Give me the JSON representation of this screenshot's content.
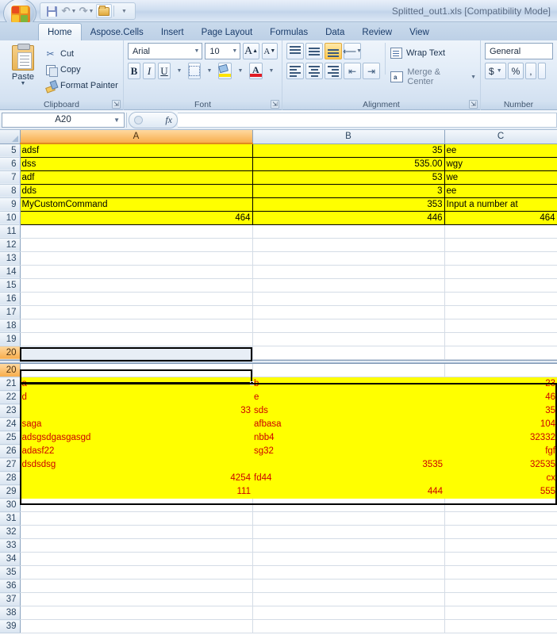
{
  "titlebar": {
    "filename": "Splitted_out1.xls  [Compatibility Mode]",
    "qat": {
      "save": "Save",
      "undo": "Undo",
      "redo": "Redo",
      "open": "Open",
      "customize": "Customize Quick Access Toolbar"
    }
  },
  "tabs": [
    {
      "label": "Home",
      "active": true
    },
    {
      "label": "Aspose.Cells",
      "active": false
    },
    {
      "label": "Insert",
      "active": false
    },
    {
      "label": "Page Layout",
      "active": false
    },
    {
      "label": "Formulas",
      "active": false
    },
    {
      "label": "Data",
      "active": false
    },
    {
      "label": "Review",
      "active": false
    },
    {
      "label": "View",
      "active": false
    }
  ],
  "ribbon": {
    "clipboard": {
      "label": "Clipboard",
      "paste": "Paste",
      "cut": "Cut",
      "copy": "Copy",
      "format_painter": "Format Painter"
    },
    "font": {
      "label": "Font",
      "family": "Arial",
      "size": "10",
      "grow_font": "A",
      "shrink_font": "A",
      "bold": "B",
      "italic": "I",
      "underline": "U",
      "fill_color_letter": "",
      "font_color_letter": "A"
    },
    "alignment": {
      "label": "Alignment",
      "wrap_text": "Wrap Text",
      "merge_center": "Merge & Center"
    },
    "number": {
      "label": "Number",
      "format": "General",
      "currency": "$",
      "percent": "%",
      "comma": ","
    }
  },
  "formulabar": {
    "namebox": "A20",
    "fx": "fx",
    "value": ""
  },
  "grid": {
    "columns": [
      "A",
      "B",
      "C"
    ],
    "active_column": "A",
    "active_row": "20",
    "top_pane_rows": [
      {
        "n": "5",
        "style": "yellowbox",
        "a": "adsf",
        "b": "35",
        "c": "ee",
        "a_align": "txt",
        "b_align": "num",
        "c_align": "txt"
      },
      {
        "n": "6",
        "style": "yellowbox",
        "a": "dss",
        "b": "535.00",
        "c": "wgy",
        "a_align": "txt",
        "b_align": "num",
        "c_align": "txt"
      },
      {
        "n": "7",
        "style": "yellowbox",
        "a": "adf",
        "b": "53",
        "c": "we",
        "a_align": "txt",
        "b_align": "num",
        "c_align": "txt"
      },
      {
        "n": "8",
        "style": "yellowbox",
        "a": "dds",
        "b": "3",
        "c": "ee",
        "a_align": "txt",
        "b_align": "num",
        "c_align": "txt"
      },
      {
        "n": "9",
        "style": "yellowbox",
        "a": "MyCustomCommand",
        "b": "353",
        "c": "Input a number at",
        "a_align": "txt",
        "b_align": "num",
        "c_align": "txt"
      },
      {
        "n": "10",
        "style": "yellowbox",
        "a": "464",
        "b": "446",
        "c": "464",
        "a_align": "num",
        "b_align": "num",
        "c_align": "num"
      },
      {
        "n": "11",
        "style": "blank",
        "a": "",
        "b": "",
        "c": "",
        "a_align": "txt",
        "b_align": "txt",
        "c_align": "txt"
      },
      {
        "n": "12",
        "style": "blank",
        "a": "",
        "b": "",
        "c": "",
        "a_align": "txt",
        "b_align": "txt",
        "c_align": "txt"
      },
      {
        "n": "13",
        "style": "blank",
        "a": "",
        "b": "",
        "c": "",
        "a_align": "txt",
        "b_align": "txt",
        "c_align": "txt"
      },
      {
        "n": "14",
        "style": "blank",
        "a": "",
        "b": "",
        "c": "",
        "a_align": "txt",
        "b_align": "txt",
        "c_align": "txt"
      },
      {
        "n": "15",
        "style": "blank",
        "a": "",
        "b": "",
        "c": "",
        "a_align": "txt",
        "b_align": "txt",
        "c_align": "txt"
      },
      {
        "n": "16",
        "style": "blank",
        "a": "",
        "b": "",
        "c": "",
        "a_align": "txt",
        "b_align": "txt",
        "c_align": "txt"
      },
      {
        "n": "17",
        "style": "blank",
        "a": "",
        "b": "",
        "c": "",
        "a_align": "txt",
        "b_align": "txt",
        "c_align": "txt"
      },
      {
        "n": "18",
        "style": "blank",
        "a": "",
        "b": "",
        "c": "",
        "a_align": "txt",
        "b_align": "txt",
        "c_align": "txt"
      },
      {
        "n": "19",
        "style": "blank",
        "a": "",
        "b": "",
        "c": "",
        "a_align": "txt",
        "b_align": "txt",
        "c_align": "txt"
      },
      {
        "n": "20",
        "style": "blank",
        "a": "",
        "b": "",
        "c": "",
        "a_align": "txt",
        "b_align": "txt",
        "c_align": "txt",
        "selected": true
      }
    ],
    "bottom_pane_rows": [
      {
        "n": "20",
        "style": "blank",
        "a": "",
        "b": "",
        "c": "",
        "a_align": "txt",
        "b_align": "txt",
        "c_align": "num",
        "selected": true
      },
      {
        "n": "21",
        "style": "yellowplain",
        "a": "a",
        "b": "b",
        "c": "23",
        "a_align": "txt",
        "b_align": "txt",
        "c_align": "num"
      },
      {
        "n": "22",
        "style": "yellowplain",
        "a": "d",
        "b": "e",
        "c": "46",
        "a_align": "txt",
        "b_align": "txt",
        "c_align": "num"
      },
      {
        "n": "23",
        "style": "yellowplain",
        "a": "33",
        "b": "sds",
        "c": "35",
        "a_align": "num",
        "b_align": "txt",
        "c_align": "num"
      },
      {
        "n": "24",
        "style": "yellowplain",
        "a": "saga",
        "b": "afbasa",
        "c": "104",
        "a_align": "txt",
        "b_align": "txt",
        "c_align": "num"
      },
      {
        "n": "25",
        "style": "yellowplain",
        "a": "adsgsdgasgasgd",
        "b": "nbb4",
        "c": "32332",
        "a_align": "txt",
        "b_align": "txt",
        "c_align": "num"
      },
      {
        "n": "26",
        "style": "yellowplain",
        "a": "adasf22",
        "b": "sg32",
        "c": "fgf",
        "a_align": "txt",
        "b_align": "txt",
        "c_align": "num"
      },
      {
        "n": "27",
        "style": "yellowplain",
        "a": "dsdsdsg",
        "b": "3535",
        "c": "32535",
        "a_align": "txt",
        "b_align": "num",
        "c_align": "num"
      },
      {
        "n": "28",
        "style": "yellowplain",
        "a": "4254",
        "b": "fd44",
        "c": "cx",
        "a_align": "num",
        "b_align": "txt",
        "c_align": "num"
      },
      {
        "n": "29",
        "style": "yellowplain",
        "a": "111",
        "b": "444",
        "c": "555",
        "a_align": "num",
        "b_align": "num",
        "c_align": "num"
      },
      {
        "n": "30",
        "style": "blank",
        "a": "",
        "b": "",
        "c": "",
        "a_align": "txt",
        "b_align": "txt",
        "c_align": "txt"
      },
      {
        "n": "31",
        "style": "blank",
        "a": "",
        "b": "",
        "c": "",
        "a_align": "txt",
        "b_align": "txt",
        "c_align": "txt"
      },
      {
        "n": "32",
        "style": "blank",
        "a": "",
        "b": "",
        "c": "",
        "a_align": "txt",
        "b_align": "txt",
        "c_align": "txt"
      },
      {
        "n": "33",
        "style": "blank",
        "a": "",
        "b": "",
        "c": "",
        "a_align": "txt",
        "b_align": "txt",
        "c_align": "txt"
      },
      {
        "n": "34",
        "style": "blank",
        "a": "",
        "b": "",
        "c": "",
        "a_align": "txt",
        "b_align": "txt",
        "c_align": "txt"
      },
      {
        "n": "35",
        "style": "blank",
        "a": "",
        "b": "",
        "c": "",
        "a_align": "txt",
        "b_align": "txt",
        "c_align": "txt"
      },
      {
        "n": "36",
        "style": "blank",
        "a": "",
        "b": "",
        "c": "",
        "a_align": "txt",
        "b_align": "txt",
        "c_align": "txt"
      },
      {
        "n": "37",
        "style": "blank",
        "a": "",
        "b": "",
        "c": "",
        "a_align": "txt",
        "b_align": "txt",
        "c_align": "txt"
      },
      {
        "n": "38",
        "style": "blank",
        "a": "",
        "b": "",
        "c": "",
        "a_align": "txt",
        "b_align": "txt",
        "c_align": "txt"
      },
      {
        "n": "39",
        "style": "blank",
        "a": "",
        "b": "",
        "c": "",
        "a_align": "txt",
        "b_align": "txt",
        "c_align": "txt"
      }
    ]
  },
  "colors": {
    "highlight_yellow": "#ffff00",
    "red_text": "#cc0000",
    "active_header": "#f7ad4c",
    "tab_active": "#f0f5fb"
  }
}
